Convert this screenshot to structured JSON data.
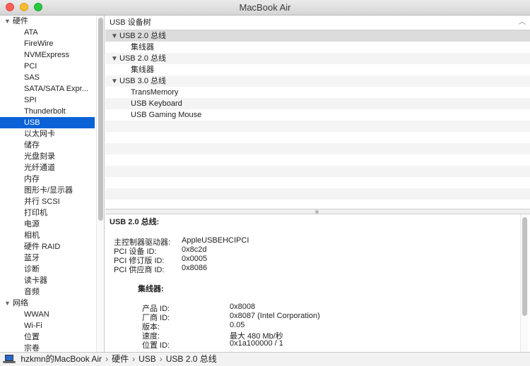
{
  "window": {
    "title": "MacBook Air"
  },
  "sidebar": {
    "hardware": {
      "label": "硬件",
      "items": [
        "ATA",
        "FireWire",
        "NVMExpress",
        "PCI",
        "SAS",
        "SATA/SATA Expr...",
        "SPI",
        "Thunderbolt",
        "USB",
        "以太网卡",
        "储存",
        "光盘刻录",
        "光纤通道",
        "内存",
        "图形卡/显示器",
        "并行 SCSI",
        "打印机",
        "电源",
        "相机",
        "硬件 RAID",
        "蓝牙",
        "诊断",
        "读卡器",
        "音频"
      ],
      "selected": "USB"
    },
    "network": {
      "label": "网络",
      "items": [
        "WWAN",
        "Wi-Fi",
        "位置",
        "宗卷"
      ]
    }
  },
  "tree": {
    "header": "USB 设备树",
    "rows": [
      {
        "label": "USB 2.0 总线",
        "level": 0,
        "expanded": true
      },
      {
        "label": "集线器",
        "level": 1
      },
      {
        "label": "USB 2.0 总线",
        "level": 0,
        "expanded": true
      },
      {
        "label": "集线器",
        "level": 1
      },
      {
        "label": "USB 3.0 总线",
        "level": 0,
        "expanded": true
      },
      {
        "label": "TransMemory",
        "level": 1
      },
      {
        "label": "USB Keyboard",
        "level": 1
      },
      {
        "label": "USB Gaming Mouse",
        "level": 1
      }
    ]
  },
  "detail": {
    "title": "USB 2.0 总线:",
    "bus_fields": [
      {
        "label": "主控制器驱动器:",
        "value": "AppleUSBEHCIPCI"
      },
      {
        "label": "PCI 设备 ID:",
        "value": "0x8c2d"
      },
      {
        "label": "PCI 修订版 ID:",
        "value": "0x0005"
      },
      {
        "label": "PCI 供应商 ID:",
        "value": "0x8086"
      }
    ],
    "hub_title": "集线器:",
    "hub_fields": [
      {
        "label": "产品 ID:",
        "value": "0x8008"
      },
      {
        "label": "厂商 ID:",
        "value": "0x8087  (Intel Corporation)"
      },
      {
        "label": "版本:",
        "value": "0.05"
      },
      {
        "label": "速度:",
        "value": "最大 480 Mb/秒"
      },
      {
        "label": "位置 ID:",
        "value": "0x1a100000 / 1"
      }
    ]
  },
  "breadcrumb": [
    "hzkmn的MacBook Air",
    "硬件",
    "USB",
    "USB 2.0 总线"
  ],
  "icons": {
    "expanded": "triangle-down",
    "sort": "chevron-up",
    "computer": "laptop-icon"
  },
  "colors": {
    "selection": "#0a62d6",
    "close": "#fc5f57",
    "minimize": "#fdbc2e",
    "maximize": "#28c840"
  }
}
